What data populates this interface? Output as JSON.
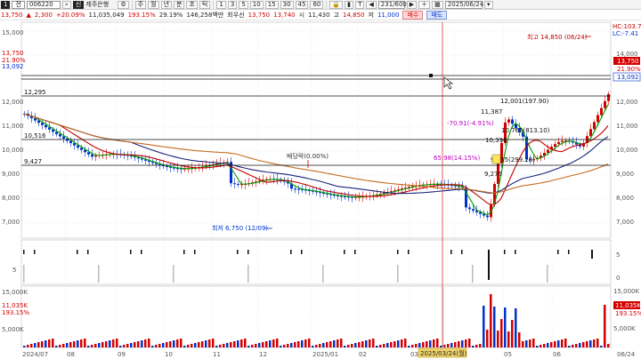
{
  "toolbar": {
    "shortcut": "1",
    "market_type": "전",
    "stock_code": "006220",
    "stock_name": "제주은행",
    "periods": [
      "주",
      "월",
      "년",
      "분",
      "초",
      "틱"
    ],
    "minute_buttons": [
      "1",
      "3",
      "5",
      "10",
      "15",
      "30",
      "45",
      "60"
    ],
    "page_indicator": "231/600",
    "date": "2025/06/24"
  },
  "quote": {
    "price": "13,750",
    "change_arrow": "▲",
    "change": "2,300",
    "change_pct": "+20.09%",
    "volume": "11,035,049",
    "volume_ratio": "193.15%",
    "turnover": "29.19%",
    "amount": "146,258백만",
    "rotation_label": "회우선",
    "sell_quote": "13,750",
    "buy_quote": "13,740",
    "open_label": "시",
    "open": "11,430",
    "high_label": "고",
    "high": "14,850",
    "low_label": "저",
    "low": "11,000",
    "buy_button": "매수",
    "sell_button": "매도"
  },
  "price_axis": {
    "ticks": [
      "15,000",
      "14,000",
      "13,000",
      "12,000",
      "11,000",
      "10,000",
      "9,000",
      "8,000",
      "7,000"
    ],
    "right_ticks": [
      "14,000",
      "12,000",
      "11,000",
      "10,000",
      "9,000",
      "8,000",
      "7,000"
    ],
    "hc_label": "HC:103.70",
    "lc_label": "LC:-7.41",
    "current_tag": "13,750",
    "current_pct": "21.90%",
    "prev_tag": "13,092",
    "left_current": "13,750",
    "left_current_pct": "21.90%",
    "left_prev": "13,092"
  },
  "levels": {
    "l1": "12,295",
    "l2": "10,516",
    "l3": "9,427"
  },
  "annotations": {
    "high": "최고 14,850 (06/24)",
    "low": "최저 6,750 (12/09)",
    "dividend": "배당락(0.00%)",
    "a1": "12,001(197.90)",
    "a2": "11,387",
    "a3": "-70.91(-4.91%)",
    "a4": "10,765(813.10)",
    "a5": "65.98(14.15%)",
    "a6": "9,955(299.28)",
    "a7": "10,396",
    "a8": "9,276"
  },
  "mid_axis": {
    "five": "5",
    "zero": "0"
  },
  "volume_axis": {
    "ticks": [
      "15,000K",
      "10,000K",
      "5,000K"
    ],
    "right_ticks": [
      "15,000K",
      "10,000K",
      "5,000K"
    ],
    "current_tag": "11,035K",
    "current_pct": "193.15%",
    "left_current": "11,035K",
    "left_current_pct": "193.15%"
  },
  "date_axis": {
    "labels": [
      "2024/07",
      "08",
      "09",
      "10",
      "11",
      "12",
      "2025/01",
      "02",
      "03",
      "04",
      "05",
      "06",
      "06/24"
    ],
    "cursor_date": "2025/03/24(월)"
  },
  "colors": {
    "up": "#d40000",
    "down": "#0033cc",
    "ma5": "#00a000",
    "ma20": "#c00000",
    "ma60": "#1a237e",
    "ma120": "#c46a1a"
  }
}
